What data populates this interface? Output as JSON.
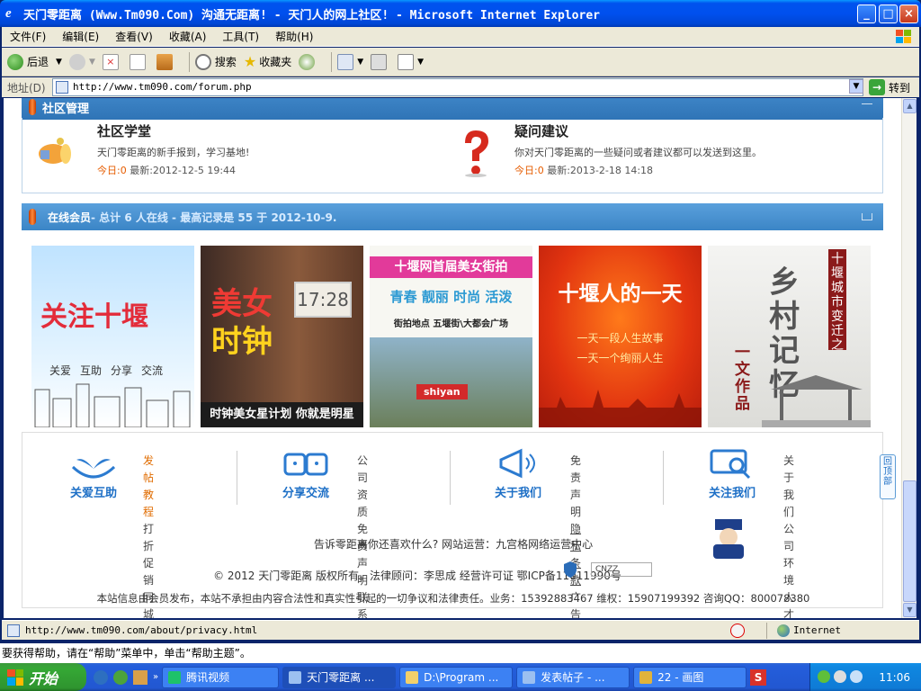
{
  "window": {
    "title": "天门零距离 (Www.Tm090.Com) 沟通无距离! - 天门人的网上社区! - Microsoft Internet Explorer",
    "minimize": "_",
    "maximize": "□",
    "close": "×"
  },
  "menu": [
    "文件(F)",
    "编辑(E)",
    "查看(V)",
    "收藏(A)",
    "工具(T)",
    "帮助(H)"
  ],
  "toolbar": {
    "back": "后退",
    "search": "搜索",
    "favorites": "收藏夹"
  },
  "address": {
    "label": "地址(D)",
    "url": "http://www.tm090.com/forum.php",
    "go": "转到"
  },
  "community": {
    "header": "社区管理",
    "forums": [
      {
        "name": "社区学堂",
        "desc": "天门零距离的新手报到，学习基地!",
        "today": "今日:0",
        "latest": "最新:2012-12-5 19:44"
      },
      {
        "name": "疑问建议",
        "desc": "你对天门零距离的一些疑问或者建议都可以发送到这里。",
        "today": "今日:0",
        "latest": "最新:2013-2-18 14:18"
      }
    ]
  },
  "online": {
    "label": "在线会员",
    "summary": " - 总计 6 人在线 - 最高记录是 55 于 2012-10-9."
  },
  "banners": [
    {
      "title": "关注十堰",
      "words": [
        "关爱",
        "互助",
        "分享",
        "交流"
      ]
    },
    {
      "title1": "美女",
      "title2": "时钟",
      "clock": "17:28",
      "caption": "时钟美女星计划 你就是明星"
    },
    {
      "title": "十堰网首届美女街拍",
      "subtitle": "青春 靓丽 时尚 活泼",
      "place": "街拍地点 五堰街\\大都会广场",
      "tag": "shiyan"
    },
    {
      "title": "十堰人的一天",
      "line1": "一天一段人生故事",
      "line2": "一天一个绚丽人生"
    },
    {
      "title": "十堰城市变迁之",
      "main": "乡村记忆",
      "side": "一文作品"
    }
  ],
  "footer": {
    "groups": [
      {
        "title": "关爱互助",
        "links": [
          "发帖教程",
          "打折促销",
          "同城交友"
        ]
      },
      {
        "title": "分享交流",
        "links": [
          "公司资质",
          "免责声明",
          "联系方式"
        ]
      },
      {
        "title": "关于我们",
        "links": [
          "免责声明",
          "隐私条款",
          "广告报价"
        ]
      },
      {
        "title": "关注我们",
        "links": [
          "关于我们",
          "公司环境",
          "人才诚聘"
        ]
      }
    ],
    "line1": "告诉零距离你还喜欢什么? 网站运营：九宫格网络运营中心",
    "line2": "© 2012 天门零距离 版权所有。法律顾问：李思成  经营许可证 鄂ICP备11011990号",
    "line3": "本站信息由会员发布，本站不承担由内容合法性和真实性引起的一切争议和法律责任。业务：15392883467 维权：15907199392 咨询QQ：800078380",
    "cnzz": "CNZZ",
    "backtop": "回顶部"
  },
  "status": {
    "url": "http://www.tm090.com/about/privacy.html",
    "zone": "Internet"
  },
  "help": "要获得帮助，请在“帮助”菜单中，单击“帮助主题”。",
  "taskbar": {
    "start": "开始",
    "tasks": [
      "腾讯视频",
      "天门零距离 ...",
      "D:\\Program ...",
      "发表帖子 - ...",
      "22 - 画图"
    ],
    "clock": "11:06"
  },
  "colors": {
    "accent": "#2f74b6",
    "orange": "#e65c00",
    "link": "#1d6fc6"
  }
}
